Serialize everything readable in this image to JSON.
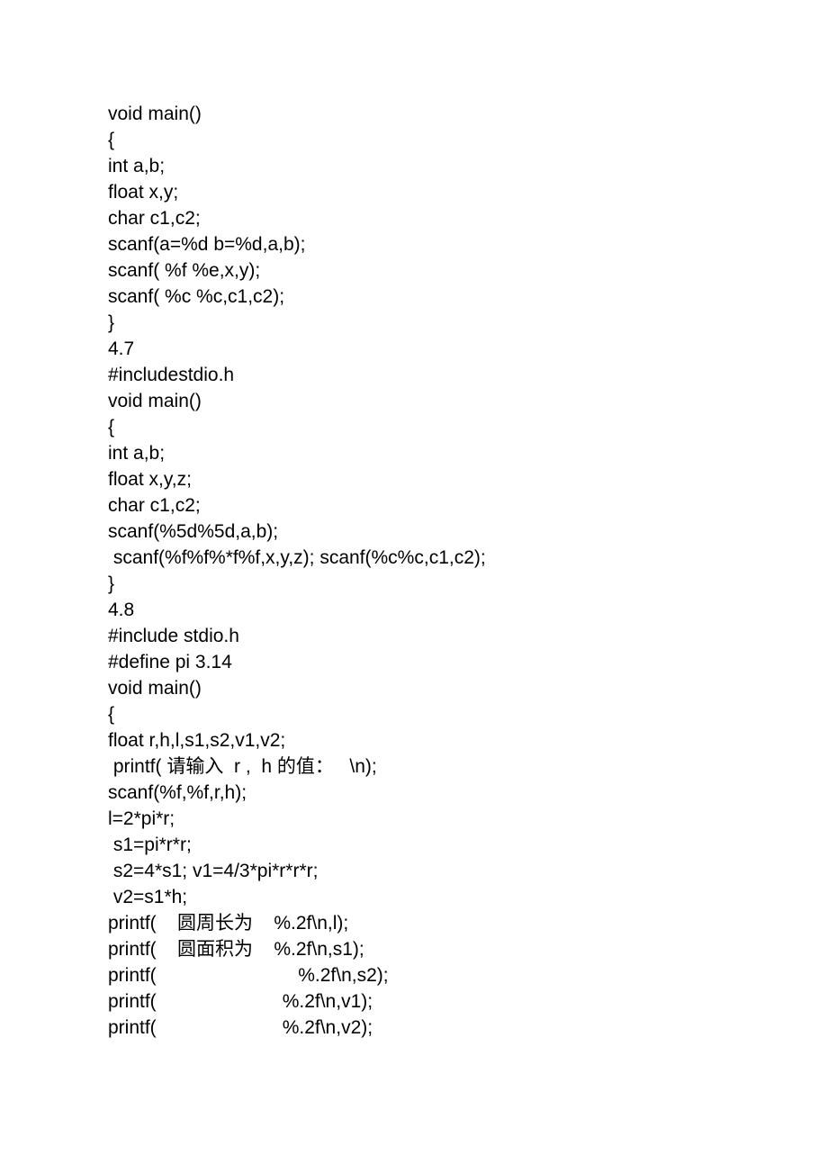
{
  "lines": [
    "void main()",
    "{",
    "int a,b;",
    "float x,y;",
    "char c1,c2;",
    "scanf(a=%d b=%d,a,b);",
    "scanf( %f %e,x,y);",
    "scanf( %c %c,c1,c2);",
    "}",
    "4.7",
    "#includestdio.h",
    "void main()",
    "{",
    "int a,b;",
    "float x,y,z;",
    "char c1,c2;",
    "scanf(%5d%5d,a,b);",
    " scanf(%f%f%*f%f,x,y,z); scanf(%c%c,c1,c2);",
    "}",
    "4.8",
    "#include stdio.h",
    "#define pi 3.14",
    "void main()",
    "{",
    "float r,h,l,s1,s2,v1,v2;",
    " printf( 请输入  r ,  h 的值：   \\n);",
    "scanf(%f,%f,r,h);",
    "l=2*pi*r;",
    " s1=pi*r*r;",
    " s2=4*s1; v1=4/3*pi*r*r*r;",
    " v2=s1*h;",
    "printf(    圆周长为    %.2f\\n,l);",
    "printf(    圆面积为    %.2f\\n,s1);",
    "printf(                           %.2f\\n,s2);",
    "printf(                        %.2f\\n,v1);",
    "printf(                        %.2f\\n,v2);"
  ]
}
